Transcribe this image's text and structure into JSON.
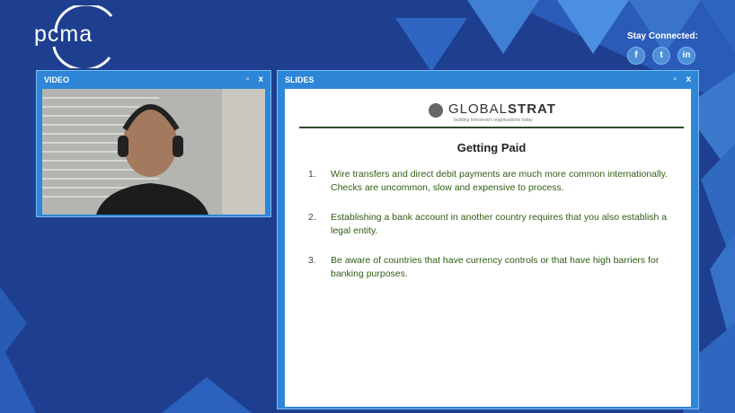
{
  "brand": {
    "logo_text": "pcma"
  },
  "social": {
    "heading": "Stay Connected:",
    "buttons": [
      {
        "icon": "facebook-icon",
        "glyph": "f"
      },
      {
        "icon": "twitter-icon",
        "glyph": "t"
      },
      {
        "icon": "linkedin-icon",
        "glyph": "in"
      }
    ]
  },
  "video_panel": {
    "title": "VIDEO",
    "restore": "▫",
    "close": "x"
  },
  "slides_panel": {
    "title": "SLIDES",
    "restore": "▫",
    "close": "x",
    "slide": {
      "company_name_light": "GLOBAL",
      "company_name_bold": "STRAT",
      "company_tagline": "building tomorrow's organizations today",
      "title": "Getting Paid",
      "items": [
        {
          "num": "1.",
          "text": "Wire transfers and direct debit payments are much more common internationally. Checks are uncommon, slow and expensive to process."
        },
        {
          "num": "2.",
          "text": "Establishing a bank account in another country requires that you also establish a legal entity."
        },
        {
          "num": "3.",
          "text": "Be aware of countries that have currency controls or that have high barriers for banking purposes."
        }
      ]
    }
  },
  "colors": {
    "background": "#1e3f8f",
    "panel": "#2d86d8",
    "slide_text": "#2f5d14"
  }
}
